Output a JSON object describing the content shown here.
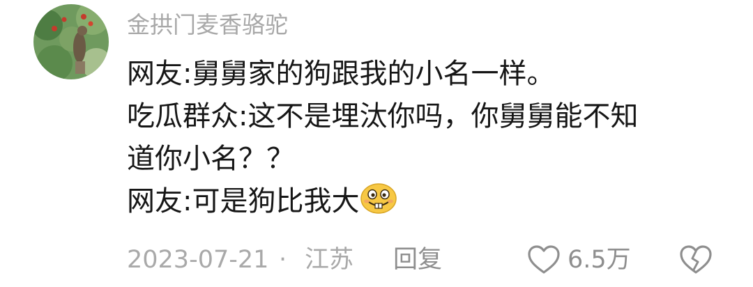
{
  "comment": {
    "username": "金拱门麦香骆驼",
    "lines": [
      "网友:舅舅家的狗跟我的小名一样。",
      "吃瓜群众:这不是埋汰你吗，你舅舅能不知",
      "道你小名？？",
      "网友:可是狗比我大"
    ],
    "emoji": "grinning-buck-teeth-emoji",
    "date": "2023-07-21",
    "separator": "·",
    "location": "江苏",
    "reply_label": "回复",
    "like_count": "6.5万",
    "icons": {
      "like": "heart-outline-icon",
      "dislike": "broken-heart-icon"
    }
  },
  "colors": {
    "username": "#a8a8a8",
    "text": "#161616",
    "meta": "#a9a9a9",
    "emoji_yellow": "#f7c844"
  }
}
